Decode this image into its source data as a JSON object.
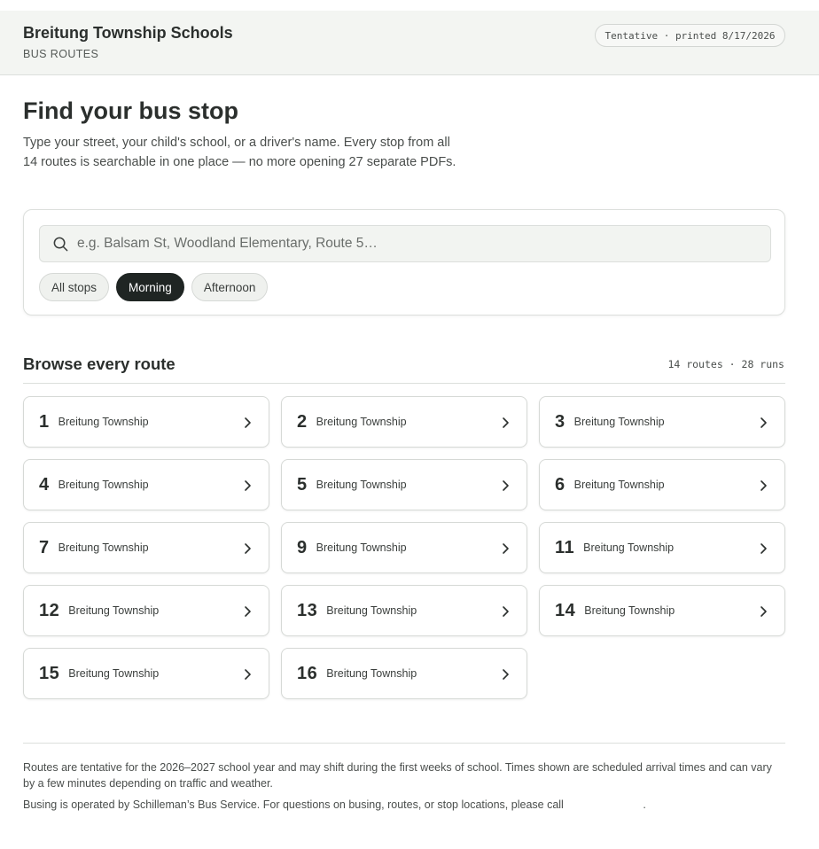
{
  "header": {
    "org_name": "Breitung Township Schools",
    "section": "BUS ROUTES",
    "status": "Tentative · printed 8/17/2026"
  },
  "page": {
    "title": "Find your bus stop",
    "intro": "Type your street, your child's school, or a driver's name. Every stop from all 14 routes is searchable in one place — no more opening 27 separate PDFs."
  },
  "search": {
    "placeholder": "e.g. Balsam St, Woodland Elementary, Route 5…",
    "value": "",
    "icon": "search-icon"
  },
  "filters": [
    {
      "label": "All stops",
      "active": false
    },
    {
      "label": "Morning",
      "active": true
    },
    {
      "label": "Afternoon",
      "active": false
    }
  ],
  "routes_section": {
    "title": "Browse every route",
    "count": "14 routes · 28 runs"
  },
  "routes": [
    {
      "number": "1",
      "name": "Breitung Township"
    },
    {
      "number": "2",
      "name": "Breitung Township"
    },
    {
      "number": "3",
      "name": "Breitung Township"
    },
    {
      "number": "4",
      "name": "Breitung Township"
    },
    {
      "number": "5",
      "name": "Breitung Township"
    },
    {
      "number": "6",
      "name": "Breitung Township"
    },
    {
      "number": "7",
      "name": "Breitung Township"
    },
    {
      "number": "9",
      "name": "Breitung Township"
    },
    {
      "number": "11",
      "name": "Breitung Township"
    },
    {
      "number": "12",
      "name": "Breitung Township"
    },
    {
      "number": "13",
      "name": "Breitung Township"
    },
    {
      "number": "14",
      "name": "Breitung Township"
    },
    {
      "number": "15",
      "name": "Breitung Township"
    },
    {
      "number": "16",
      "name": "Breitung Township"
    }
  ],
  "footer": {
    "note": "Routes are tentative for the 2026–2027 school year and may shift during the first weeks of school. Times shown are scheduled arrival times and can vary by a few minutes depending on traffic and weather.",
    "contact": "Busing is operated by Schilleman’s Bus Service. For questions on busing, routes, or stop locations, please call",
    "contact_end": "."
  },
  "colors": {
    "accent_dark": "#1f2523",
    "header_bg": "#f3f5f2",
    "border": "#dcdfdc"
  }
}
